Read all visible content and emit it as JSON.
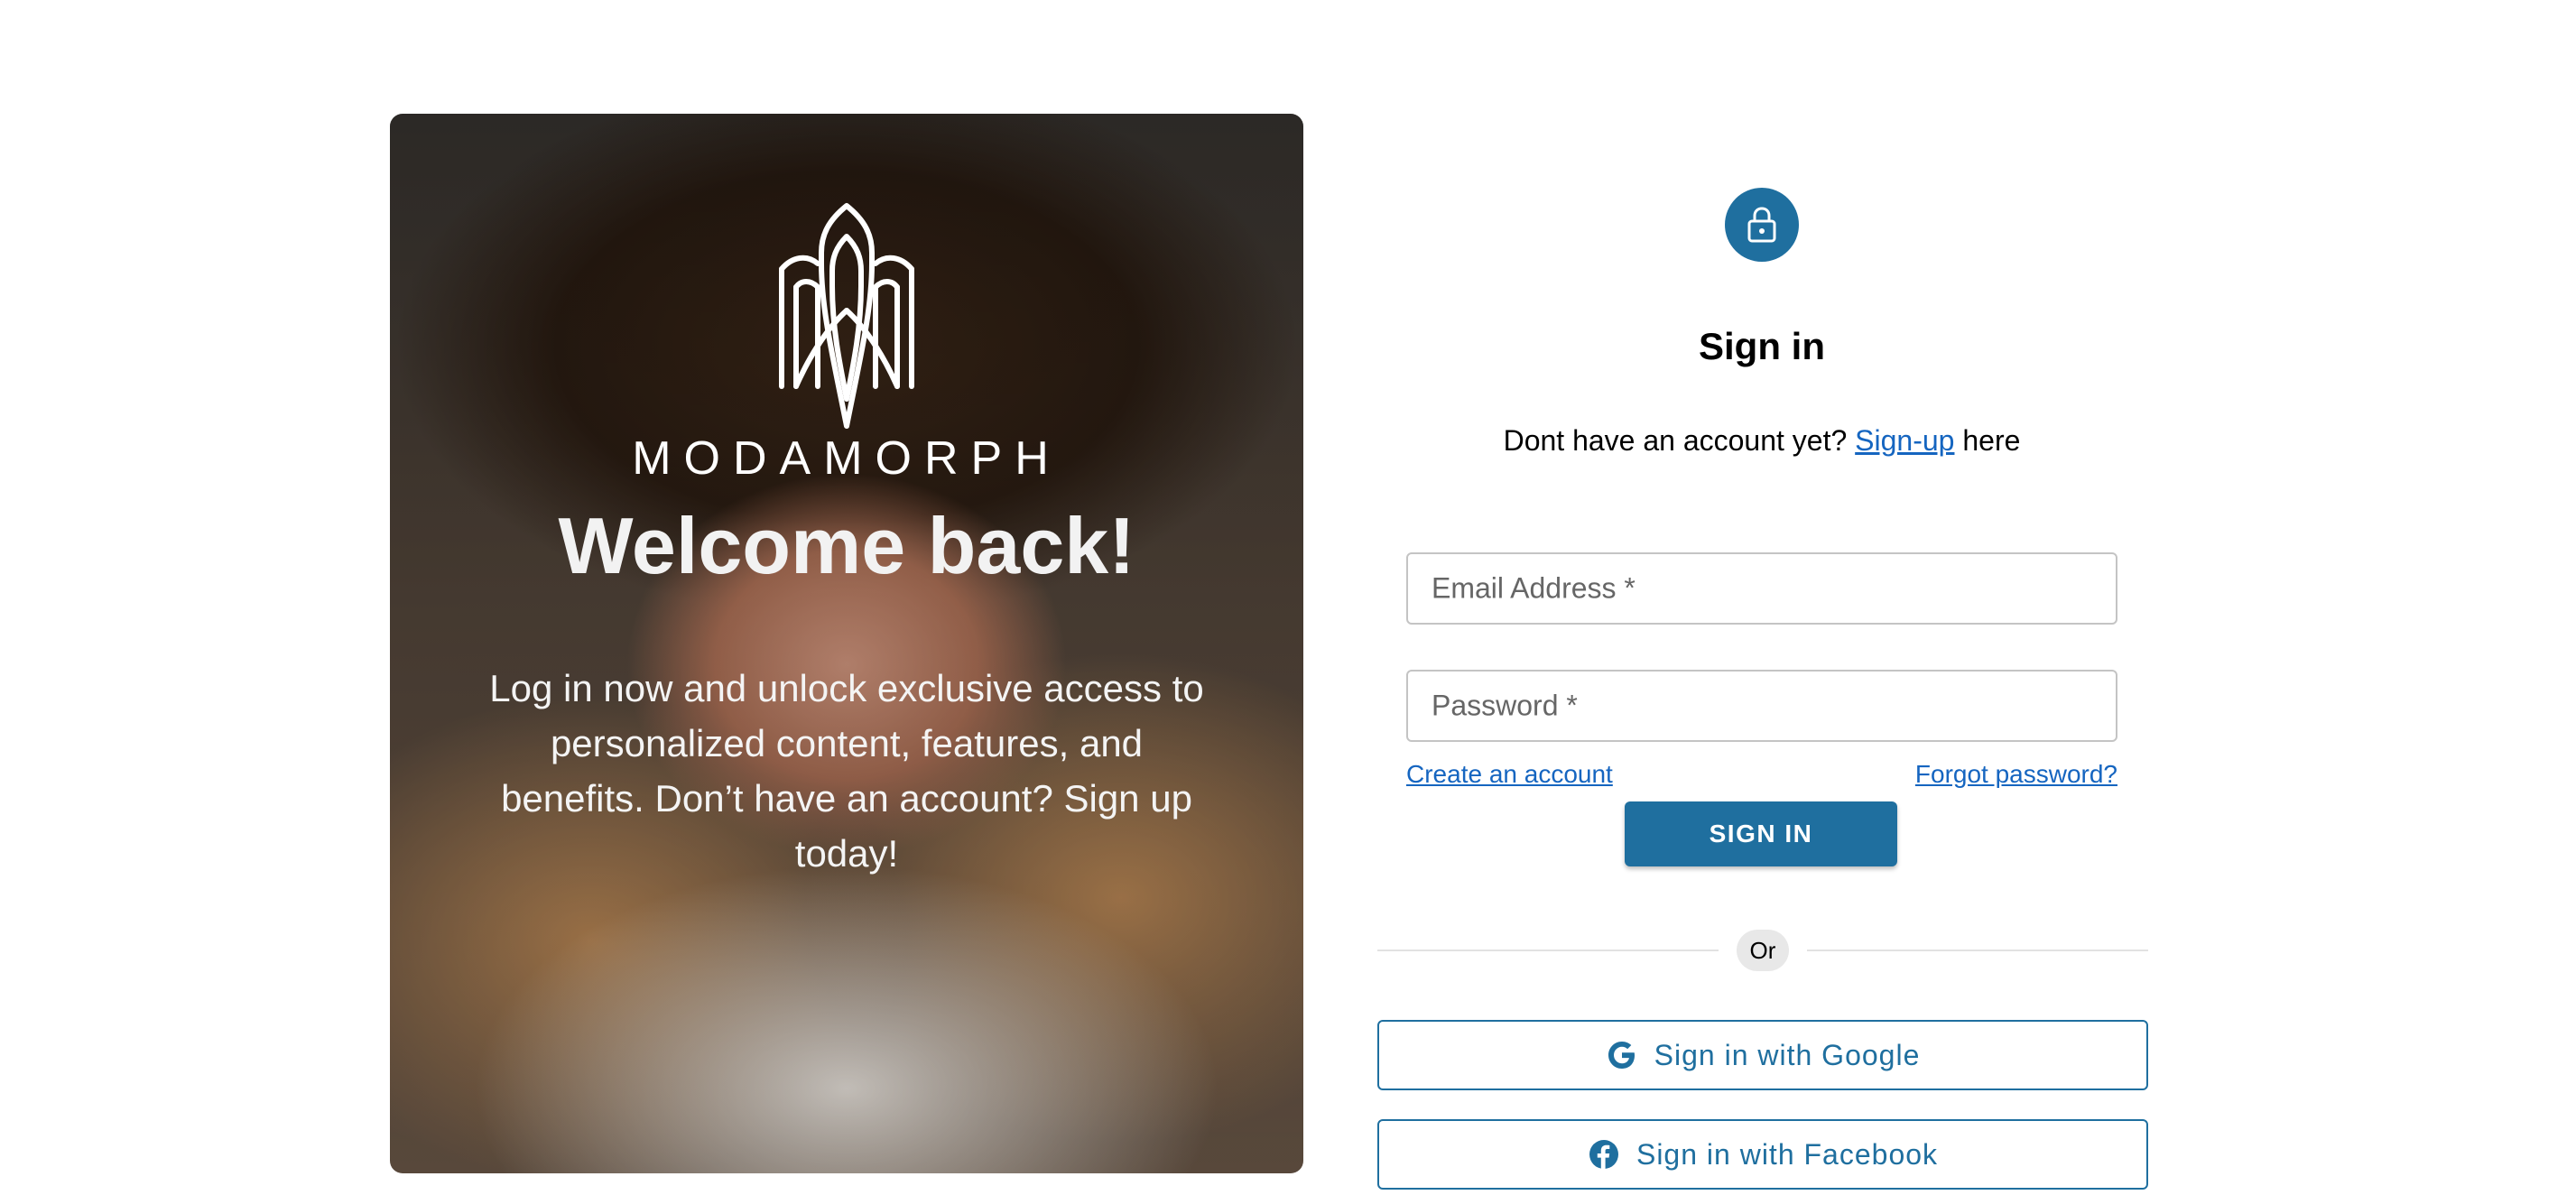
{
  "hero": {
    "brand": "MODAMORPH",
    "title": "Welcome back!",
    "text": "Log in now and unlock exclusive access to personalized content, features, and benefits. Don’t have an account? Sign up today!"
  },
  "signin": {
    "title": "Sign in",
    "prompt_prefix": "Dont have an account yet?",
    "prompt_link": "Sign-up",
    "prompt_suffix": "here",
    "email_label": "Email Address *",
    "password_label": "Password *",
    "create_account": "Create an account",
    "forgot_password": "Forgot password?",
    "submit": "SIGN IN",
    "divider": "Or",
    "google": "Sign in with Google",
    "facebook": "Sign in with Facebook"
  },
  "colors": {
    "primary": "#1f6f9f",
    "link": "#1565c0"
  },
  "icons": {
    "avatar": "lock-icon",
    "google": "google-icon",
    "facebook": "facebook-icon"
  }
}
